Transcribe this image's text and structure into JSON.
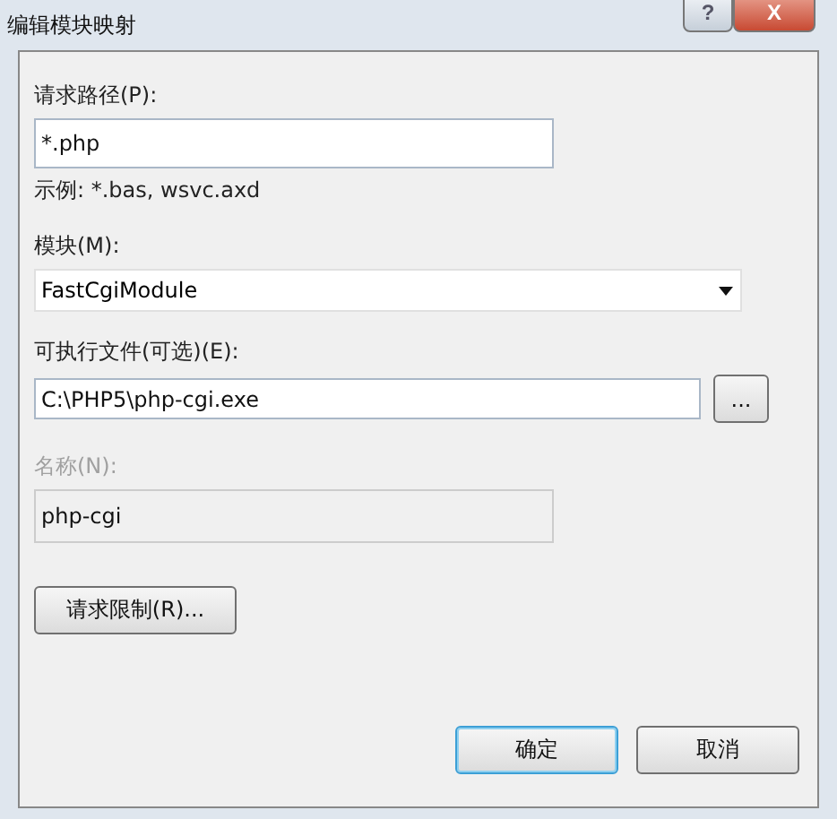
{
  "window": {
    "title": "编辑模块映射",
    "caption_buttons": [
      {
        "kind": "help",
        "label": "?"
      },
      {
        "kind": "close",
        "label": "X"
      }
    ]
  },
  "request_path": {
    "label": "请求路径(P):",
    "value": "*.php",
    "example": "示例: *.bas, wsvc.axd"
  },
  "module": {
    "label": "模块(M):",
    "value": "FastCgiModule"
  },
  "executable": {
    "label": "可执行文件(可选)(E):",
    "value": "C:\\PHP5\\php-cgi.exe",
    "browse": "..."
  },
  "name": {
    "label": "名称(N):",
    "value": "php-cgi",
    "disabled": true
  },
  "restrictions_button": "请求限制(R)...",
  "buttons": [
    {
      "label": "确定",
      "focused": true
    },
    {
      "label": "取消",
      "focused": false
    }
  ]
}
